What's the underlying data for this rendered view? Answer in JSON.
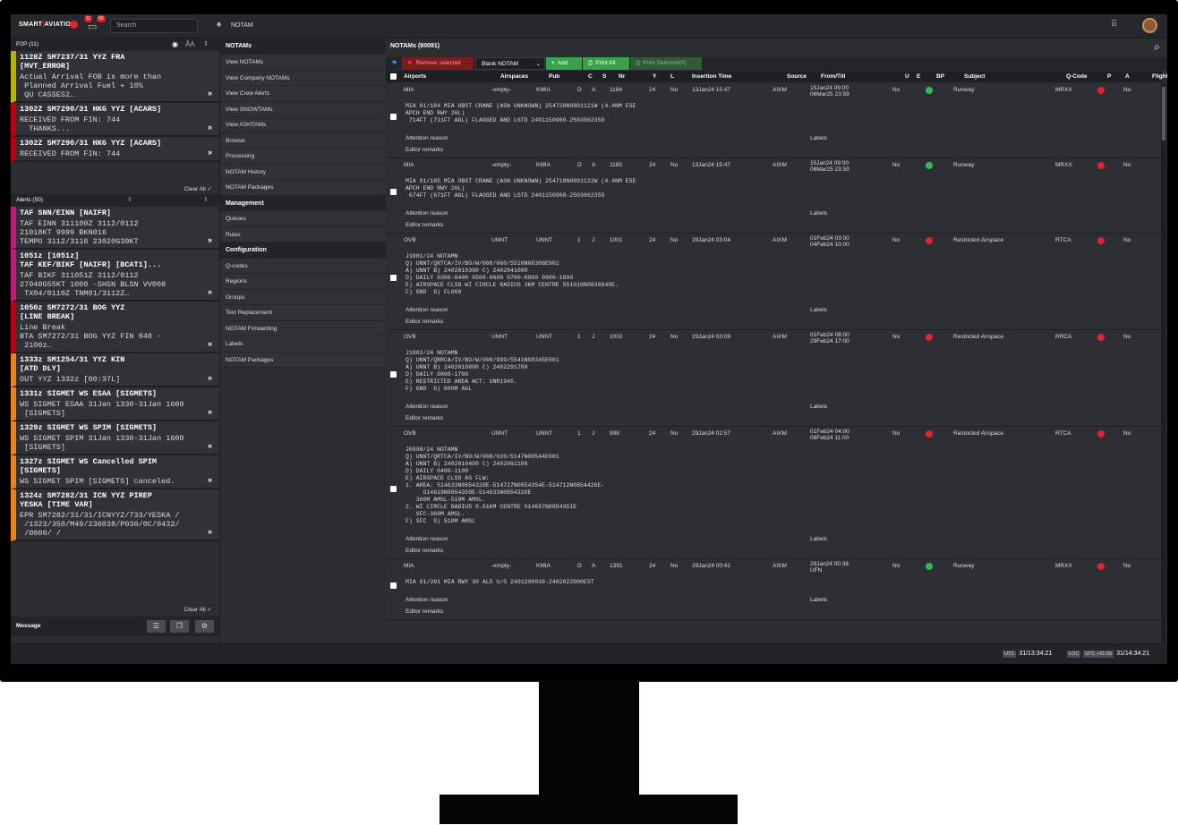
{
  "header": {
    "logo_a": "SMART",
    "logo_b": "AVIATION",
    "badge1": "11",
    "badge2": "50",
    "search_placeholder": "Search",
    "nav_title": "NOTAM"
  },
  "p2p": {
    "title": "P2P (11)",
    "controls": "ÂA"
  },
  "p2p_cards": [
    {
      "title": "1128Z SM7237/31 YYZ FRA\n[MVT_ERROR]",
      "body": "Actual Arrival FOB is more than\n Planned Arrival Fuel + 10%\n QU CASSES2…",
      "color": "#b5b400"
    },
    {
      "title": "1302Z SM7290/31 HKG YYZ [ACARS]",
      "body": "RECEIVED FROM FIN: 744\n  THANKS...",
      "color": "#c0000f"
    },
    {
      "title": "1302Z SM7290/31 HKG YYZ [ACARS]",
      "body": "RECEIVED FROM FIN: 744",
      "color": "#c0000f"
    }
  ],
  "clear_all": "Clear All ✓",
  "alerts": {
    "title": "Alerts (50)"
  },
  "alert_cards": [
    {
      "title": "TAF SNN/EINN [NAIFR]",
      "body": "TAF EINN 311100Z 3112/0112\n21018KT 9999 BKN016\nTEMPO 3112/3116 23020G30KT",
      "color": "#c4187a"
    },
    {
      "title": "1051z [1051z]\nTAF KEF/BIKF [NAIFR] [BCAT1]...",
      "body": "TAF BIKF 311051Z 3112/0112\n27040G55KT 1000 -SHSN BLSN VV008\n TX04/0110Z TNM01/3112Z…",
      "color": "#c4187a"
    },
    {
      "title": "1050z SM7272/31 BOG YYZ\n[LINE BREAK]",
      "body": "Line Break\nBTA SM7272/31 BOG YYZ FIN 940 -\n 2100z…",
      "color": "#c0000f"
    },
    {
      "title": "1333z SM1254/31 YYZ KIN\n[ATD DLY]",
      "body": "OUT YYZ 1332z [00:37L]",
      "color": "#e8841b"
    },
    {
      "title": "1331z SIGMET WS ESAA [SIGMETS]",
      "body": "WS SIGMET ESAA 31Jan 1330-31Jan 1600\n [SIGMETS]",
      "color": "#e8841b"
    },
    {
      "title": "1329z SIGMET WS SPIM [SIGMETS]",
      "body": "WS SIGMET SPIM 31Jan 1330-31Jan 1600\n [SIGMETS]",
      "color": "#e8841b"
    },
    {
      "title": "1327z SIGMET WS Cancelled SPIM\n[SIGMETS]",
      "body": "WS SIGMET SPIM [SIGMETS] canceled.",
      "color": "#e8841b"
    },
    {
      "title": "1324z SM7282/31 ICN YYZ PIREP\nYESKA [TIME VAR]",
      "body": "EPR SM7282/31/31/ICNYYZ/733/YESKA /\n /1323/350/M49/236038/P030/0C/0432/\n /0000/ /",
      "color": "#e8841b"
    }
  ],
  "message_label": "Message",
  "menu": {
    "title": "NOTAMs",
    "items": [
      "View NOTAMs",
      "View Company NOTAMs",
      "View Crew Alerts",
      "View SNOWTAMs",
      "View ASHTAMs",
      "Browse",
      "Processing",
      "NOTAM History",
      "NOTAM Packages"
    ],
    "management": "Management",
    "mgmt_items": [
      "Queues",
      "Rules"
    ],
    "configuration": "Configuration",
    "cfg_items": [
      "Q-codes",
      "Regions",
      "Groups",
      "Text Replacement",
      "NOTAM Forwarding",
      "Labels",
      "NOTAM Packages"
    ]
  },
  "notams": {
    "title": "NOTAMs (80091)",
    "remove": "Remove selected",
    "blank": "Blank NOTAM",
    "add": "Add",
    "print_all": "Print All",
    "print_sel": "Print Selected(0)",
    "columns": [
      "Airports",
      "Airspaces",
      "Pub",
      "C",
      "S",
      "Nr",
      "Y",
      "L",
      "Insertion Time",
      "Source",
      "From/Till",
      "U",
      "E",
      "BP",
      "Subject",
      "Q-Code",
      "P",
      "A",
      "Flight"
    ],
    "attention": "Attention reason",
    "editor": "Editor remarks",
    "labels": "Labels",
    "rows": [
      {
        "airport": "MIA",
        "airspace": "-empty-",
        "pub": "KMIA",
        "c": "D",
        "s": "A",
        "nr": "1184",
        "y": "24",
        "l": "No",
        "ins": "13Jan24 15:47",
        "src": "AIXM",
        "from": "15Jan24 09:00",
        "till": "06Mar25 23:59",
        "u": "No",
        "bp": "#2dbd55",
        "subject": "Runway",
        "qcode": "MRXX",
        "a": "No",
        "text": "MIA 01/184 MIA OBST CRANE (ASN UNKNOWN) 254728N0801121W (4.4NM ESE\nAPCH END RWY 26L)\n 714FT (711FT AGL) FLAGGED AND LGTD 2401150900-2503062359"
      },
      {
        "airport": "MIA",
        "airspace": "-empty-",
        "pub": "KMIA",
        "c": "D",
        "s": "A",
        "nr": "1185",
        "y": "24",
        "l": "No",
        "ins": "13Jan24 15:47",
        "src": "AIXM",
        "from": "15Jan24 09:00",
        "till": "06Mar25 23:59",
        "u": "No",
        "bp": "#2dbd55",
        "subject": "Runway",
        "qcode": "MRXX",
        "a": "No",
        "text": "MIA 01/185 MIA OBST CRANE (ASN UNKNOWN) 254718N0801122W (4.4NM ESE\nAPCH END RWY 26L)\n 674FT (671FT AGL) FLAGGED AND LGTD 2401150900-2503062359"
      },
      {
        "airport": "OVB",
        "airspace": "UNNT",
        "pub": "UNNT",
        "c": "1",
        "s": "J",
        "nr": "1001",
        "y": "24",
        "l": "No",
        "ins": "29Jan24 03:04",
        "src": "AIXM",
        "from": "01Feb24 03:00",
        "till": "04Feb24 10:00",
        "u": "No",
        "bp": "#e0242e",
        "subject": "Restricted Airspace",
        "qcode": "RTCA",
        "a": "No",
        "text": "J1001/24 NOTAMN\nQ) UNNT/QRTCA/IV/BO/W/000/060/5510N08308E002\nA) UNNT B) 2402010300 C) 2402041000\nD) DAILY 0300-0400 0500-0600 0700-0800 0900-1000\nE) AIRSPACE CLSD WI CIRCLE RADIUS 3KM CENTRE 551010N0830840E.\nF) GND  G) FL060"
      },
      {
        "airport": "OVB",
        "airspace": "UNNT",
        "pub": "UNNT",
        "c": "1",
        "s": "J",
        "nr": "1002",
        "y": "24",
        "l": "No",
        "ins": "29Jan24 03:09",
        "src": "AIXM",
        "from": "01Feb24 08:00",
        "till": "29Feb24 17:00",
        "u": "No",
        "bp": "#e0242e",
        "subject": "Restricted Airspace",
        "qcode": "RRCA",
        "a": "No",
        "text": "J1002/24 NOTAMN\nQ) UNNT/QRRCA/IV/BO/W/000/999/5541N08345E001\nA) UNNT B) 2402010800 C) 2402291700\nD) DAILY 0800-1700\nE) RESTRICTED AREA ACT: UNR1945.\nF) GND  G) 600M AGL"
      },
      {
        "airport": "OVB",
        "airspace": "UNNT",
        "pub": "UNNT",
        "c": "1",
        "s": "J",
        "nr": "998",
        "y": "24",
        "l": "No",
        "ins": "29Jan24 02:57",
        "src": "AIXM",
        "from": "01Feb24 04:00",
        "till": "06Feb24 11:00",
        "u": "No",
        "bp": "#e0242e",
        "subject": "Restricted Airspace",
        "qcode": "RTCA",
        "a": "No",
        "text": "J0998/24 NOTAMN\nQ) UNNT/QRTCA/IV/BO/W/000/020/5147N08544E001\nA) UNNT B) 2402010400 C) 2402061100\nD) DAILY 0400-1100\nE) AIRSPACE CLSD AS FLW:\n1. AREA: 514633N0854320E-514727N0854354E-514712N0854426E-\n     514619N0854359E-514633N0854320E\n   360M AMSL-510M AMSL.\n2. WI CIRCLE RADIUS 0.01KM CENTRE 514657N0854351E\n   SFC-360M AMSL.\nF) SFC  G) 510M AMSL"
      },
      {
        "airport": "MIA",
        "airspace": "-empty-",
        "pub": "KMIA",
        "c": "D",
        "s": "A",
        "nr": "1391",
        "y": "24",
        "l": "No",
        "ins": "29Jan24 00:41",
        "src": "AIXM",
        "from": "29Jan24 00:38",
        "till": "UFN",
        "u": "No",
        "bp": "#2dbd55",
        "subject": "Runway",
        "qcode": "MRXX",
        "a": "No",
        "text": "MIA 01/391 MIA RWY 30 ALS U/S 2401290038-2402022000EST"
      }
    ]
  },
  "footer": {
    "utc_tag": "UTC",
    "utc": "31/13:34:21",
    "loc_tag": "LOC",
    "loc_offset": "UTC +01:00",
    "loc": "31/14:34:21"
  },
  "icons": [
    "bell-icon",
    "chat-icon",
    "grid-icon",
    "search-icon",
    "eye-icon",
    "printer-icon",
    "plus-icon",
    "close-icon",
    "gear-icon"
  ]
}
